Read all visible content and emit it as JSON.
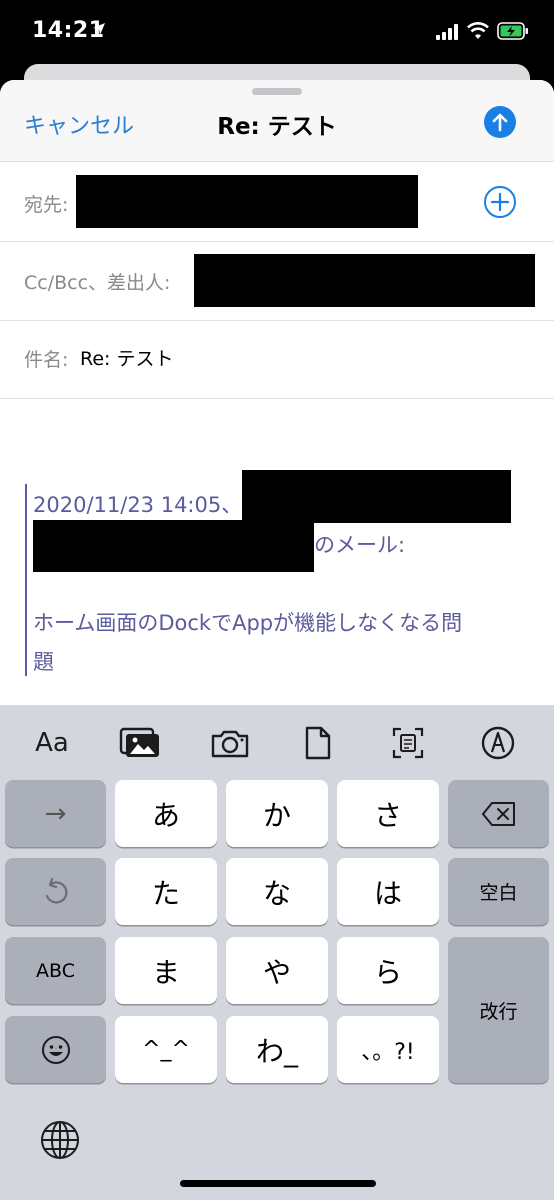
{
  "status_bar": {
    "time": "14:21"
  },
  "compose": {
    "cancel_label": "キャンセル",
    "title": "Re: テスト",
    "to_label": "宛先:",
    "cc_label": "Cc/Bcc、差出人:",
    "subject_label": "件名:",
    "subject_value": "Re: テスト"
  },
  "quote": {
    "line1": "2020/11/23 14:05、",
    "line2_suffix": "のメール:",
    "line3": "ホーム画面のDockでAppが機能しなくなる問",
    "line4": "題"
  },
  "toolbar": {
    "format_label": "Aa",
    "icons": [
      "photo-library-icon",
      "camera-icon",
      "document-icon",
      "scan-icon",
      "markup-icon"
    ]
  },
  "keyboard": {
    "arrow": "→",
    "a": "あ",
    "ka": "か",
    "sa": "さ",
    "ta": "た",
    "na": "な",
    "ha": "は",
    "abc": "ABC",
    "ma": "ま",
    "ya": "や",
    "ra": "ら",
    "emoticon": "^_^",
    "wa": "わ_",
    "punct": "、。?!",
    "space": "空白",
    "enter": "改行"
  },
  "colors": {
    "accent": "#2d7dd2",
    "quote": "#5b5b9e",
    "send": "#1a7fe4"
  }
}
